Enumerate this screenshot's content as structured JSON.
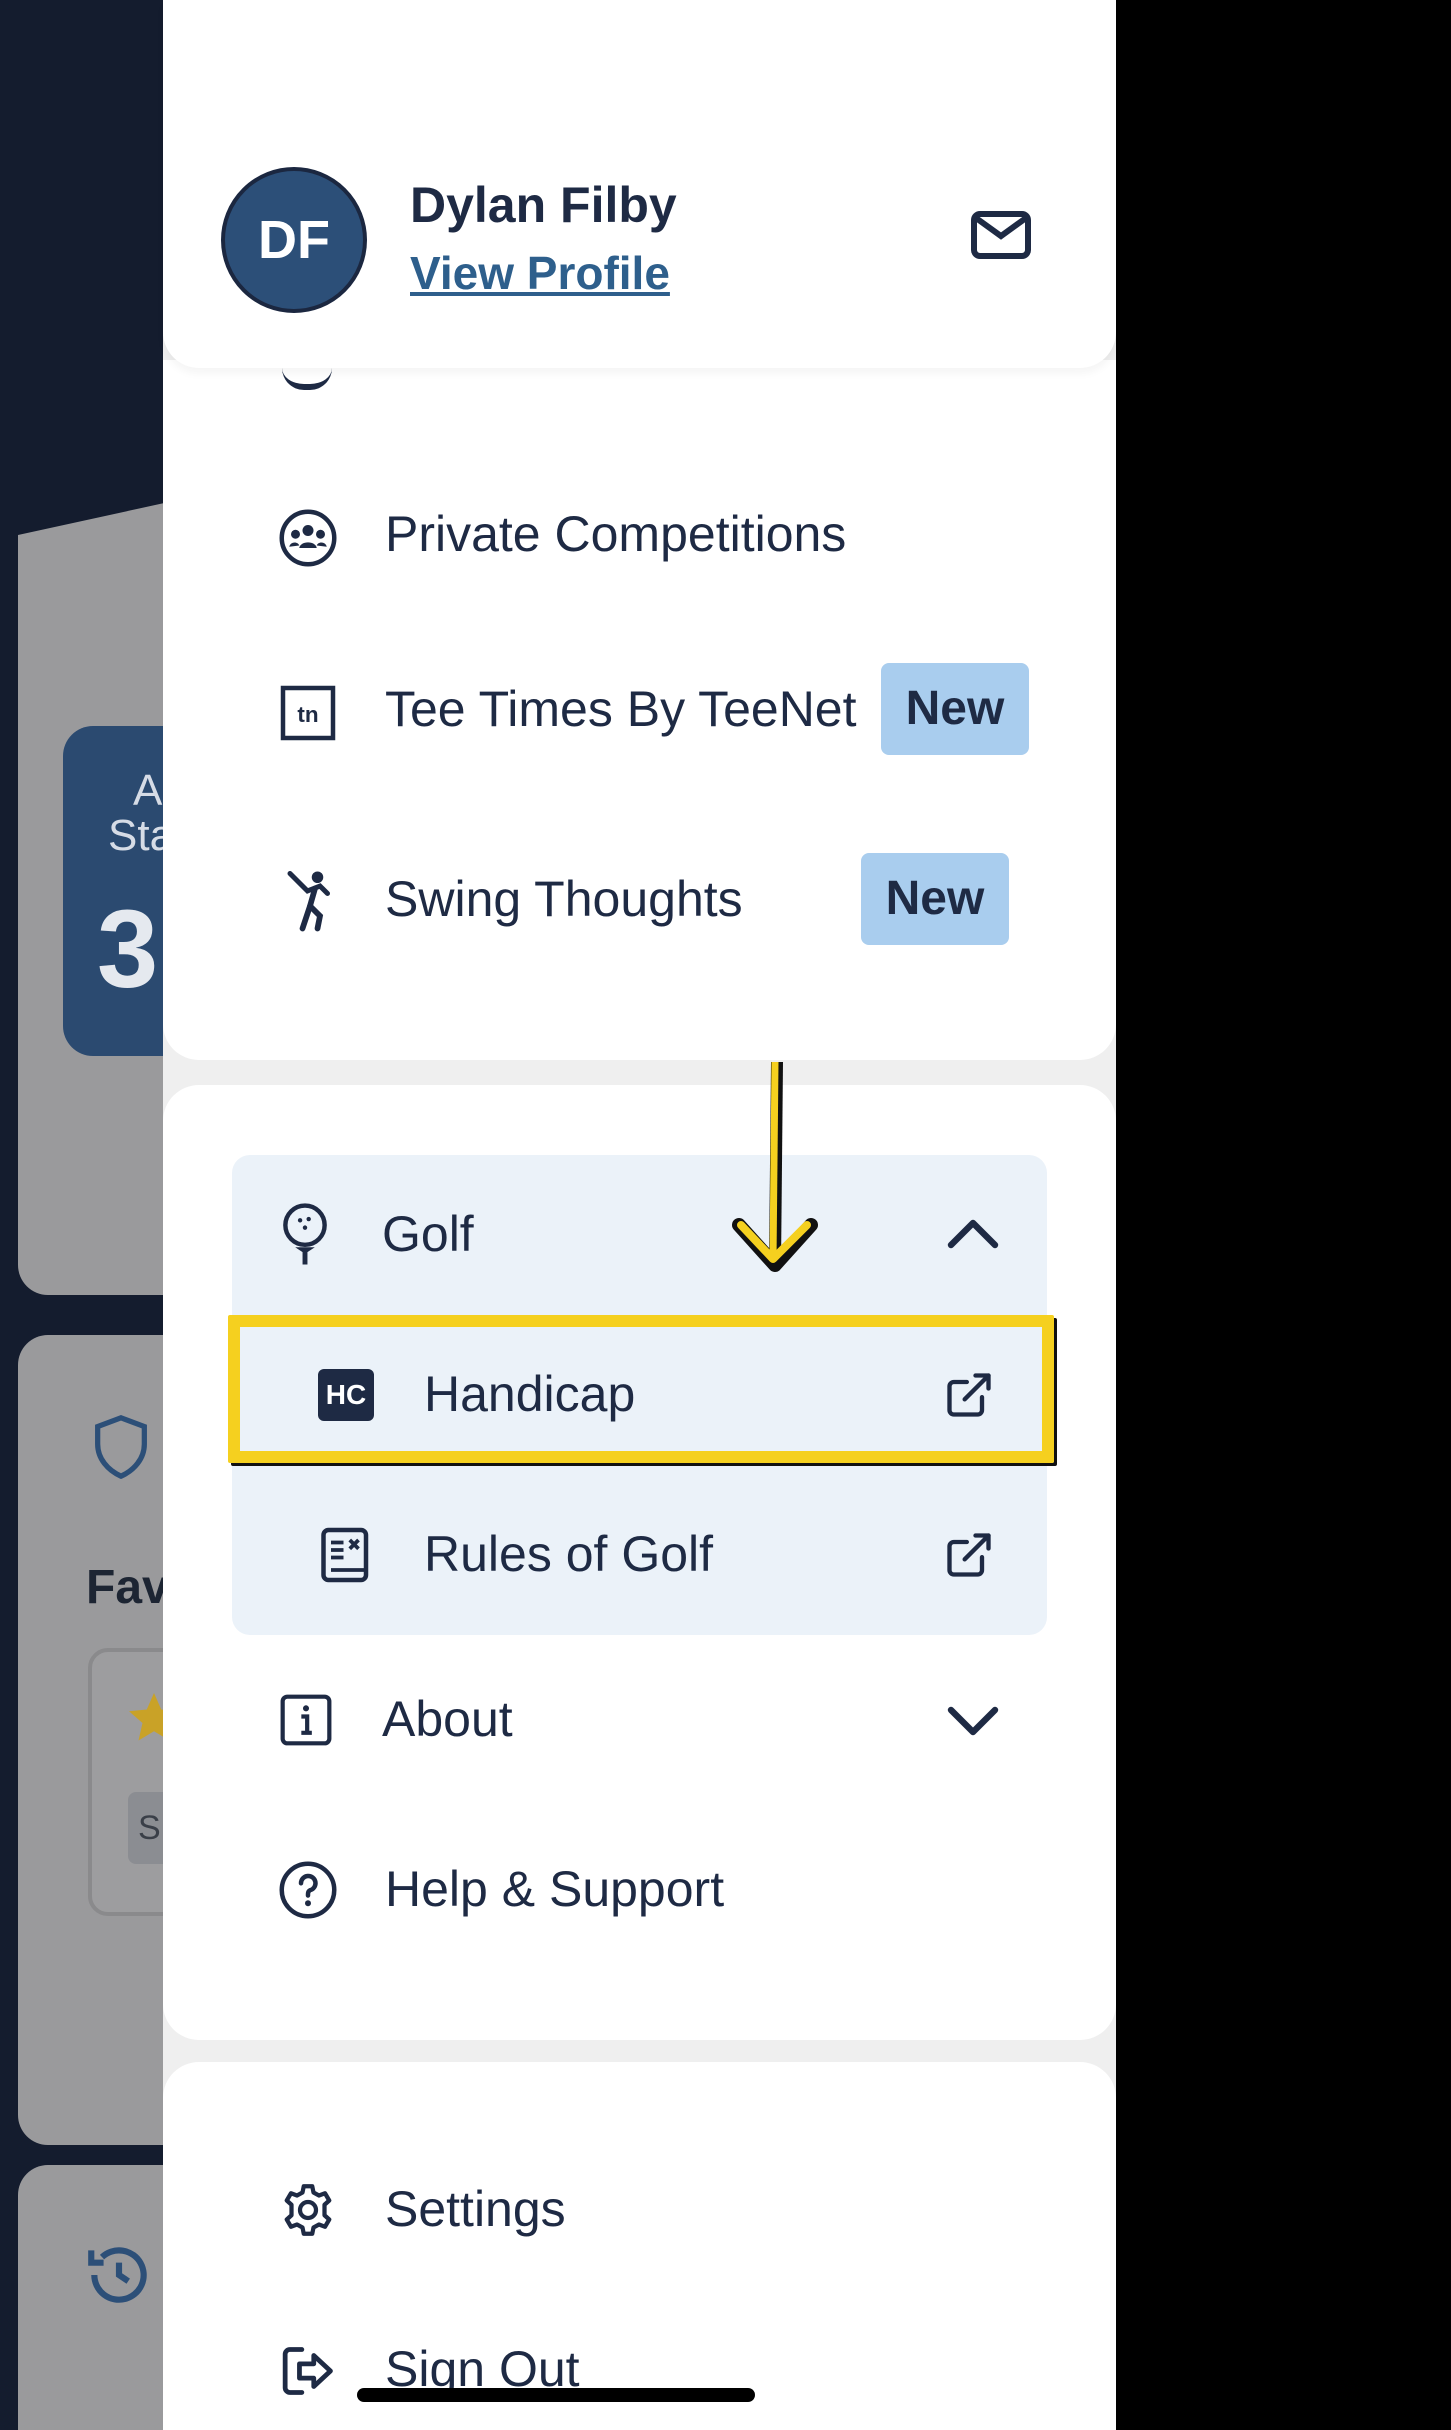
{
  "background_app": {
    "stat_card": {
      "line1": "A",
      "line2": "Sta",
      "value": "3"
    },
    "favorites_heading": "Fav",
    "chip_text": "S"
  },
  "profile": {
    "initials": "DF",
    "name": "Dylan Filby",
    "view_profile_label": "View Profile"
  },
  "menu_primary": [
    {
      "label": "Private Competitions",
      "icon": "group-icon"
    },
    {
      "label": "Tee Times By TeeNet",
      "icon": "teenet-icon",
      "badge": "New"
    },
    {
      "label": "Swing Thoughts",
      "icon": "golfer-swing-icon",
      "badge": "New"
    }
  ],
  "golf_section": {
    "label": "Golf",
    "expanded": true,
    "items": [
      {
        "label": "Handicap",
        "icon_text": "HC",
        "external": true,
        "highlighted": true
      },
      {
        "label": "Rules of Golf",
        "external": true
      }
    ]
  },
  "menu_secondary": [
    {
      "label": "About",
      "icon": "info-icon",
      "expandable": true
    },
    {
      "label": "Help & Support",
      "icon": "help-circle-icon"
    }
  ],
  "menu_bottom": [
    {
      "label": "Settings",
      "icon": "gear-icon"
    },
    {
      "label": "Sign Out",
      "icon": "sign-out-icon"
    }
  ],
  "colors": {
    "accent_badge": "#a9cdee",
    "avatar_bg": "#2c4f78",
    "link": "#2e5f8c",
    "highlight": "#f5d01f",
    "golf_panel_bg": "#ebf2f9",
    "text": "#1e2a44"
  }
}
